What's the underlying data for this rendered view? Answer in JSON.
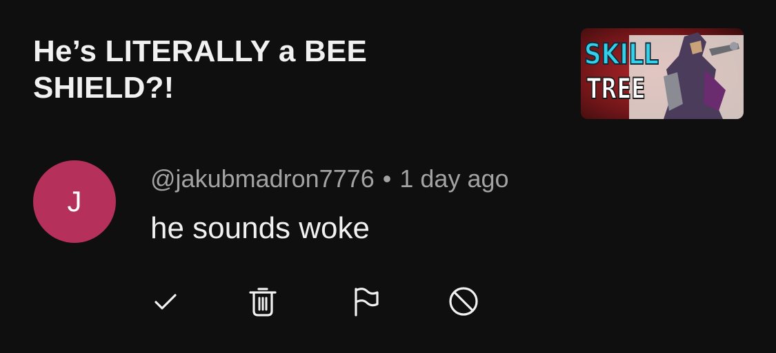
{
  "video": {
    "title": "He’s LITERALLY a BEE SHIELD?!",
    "thumbnail": {
      "text_line1": "SKILL",
      "text_line2": "TREE"
    }
  },
  "comment": {
    "avatar_initial": "J",
    "avatar_color": "#b5315c",
    "author": "@jakubmadron7776",
    "separator": "•",
    "timestamp": "1 day ago",
    "text": "he sounds woke"
  },
  "actions": [
    {
      "icon": "check-icon",
      "action": "approve"
    },
    {
      "icon": "trash-icon",
      "action": "remove"
    },
    {
      "icon": "flag-icon",
      "action": "report"
    },
    {
      "icon": "block-icon",
      "action": "hide user"
    }
  ],
  "colors": {
    "background": "#0f0f0f",
    "primary_text": "#f1f1f1",
    "secondary_text": "#a3a3a3"
  }
}
